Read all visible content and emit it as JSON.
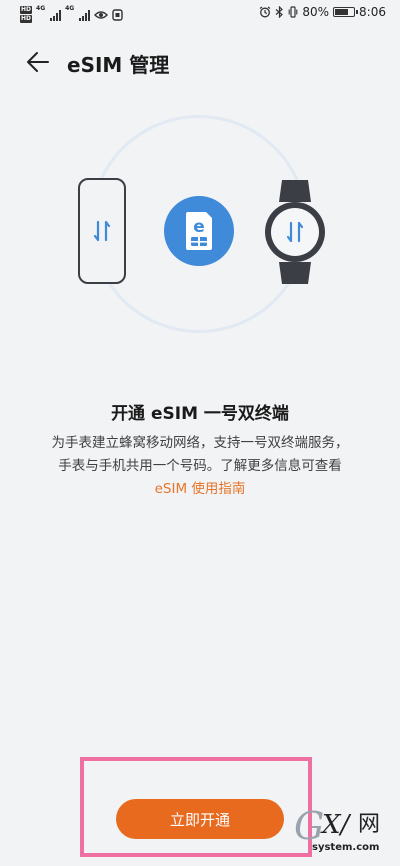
{
  "status_bar": {
    "network_left": "4G",
    "network_right": "4G",
    "battery": "80%",
    "battery_level": 0.8,
    "time": "8:06"
  },
  "header": {
    "back_icon": "arrow-left-icon",
    "title": "eSIM 管理"
  },
  "illustration": {
    "phone_icon": "phone-icon",
    "sim_icon": "esim-card-icon",
    "sim_letter": "e",
    "watch_icon": "smartwatch-icon",
    "accent_color": "#3f8ad9"
  },
  "content": {
    "heading": "开通 eSIM 一号双终端",
    "description_line1": "为手表建立蜂窝移动网络，支持一号双终端服务，",
    "description_line2": "手表与手机共用一个号码。了解更多信息可查看",
    "guide_link": "eSIM 使用指南",
    "link_color": "#e8762a"
  },
  "actions": {
    "activate_label": "立即开通",
    "button_color": "#e76a1f",
    "highlight_color": "#ef6fa3"
  },
  "watermark": {
    "brand_g": "G",
    "brand_xi": "X/",
    "brand_wang": "网",
    "url": "system.com"
  }
}
